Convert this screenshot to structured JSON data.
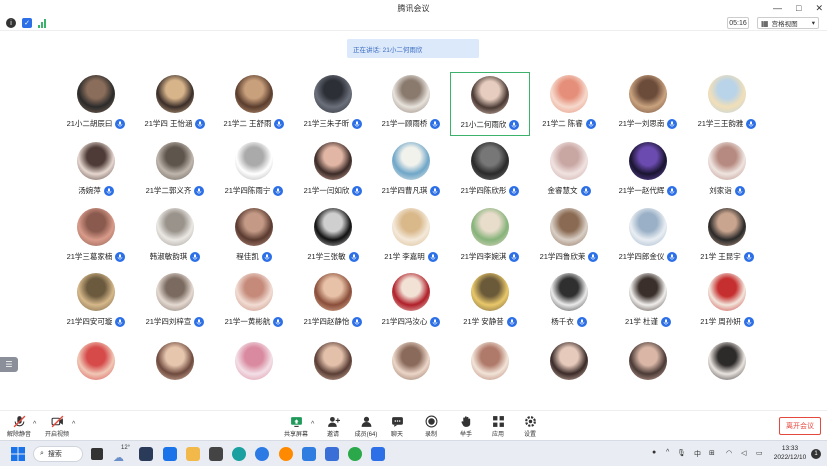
{
  "window": {
    "title": "腾讯会议"
  },
  "infobar": {
    "timer": "05:16",
    "view_label": "宫格视图"
  },
  "speaker": {
    "text": "正在讲话: 21小二何雨欣"
  },
  "participants": [
    {
      "name": "21小二胡辰曰",
      "c1": "#2b2b2b",
      "c2": "#8a6d5a"
    },
    {
      "name": "21学四 王怡涵",
      "c1": "#3a2e2a",
      "c2": "#d8b48a"
    },
    {
      "name": "21学二 王舒雨",
      "c1": "#5a3d2e",
      "c2": "#c9a07c"
    },
    {
      "name": "21学三朱子昕",
      "c1": "#6a6f7a",
      "c2": "#2d2f36"
    },
    {
      "name": "21学一顾雨桥",
      "c1": "#e7e2dc",
      "c2": "#8a7a6e"
    },
    {
      "name": "21小二何雨欣",
      "c1": "#4a3a34",
      "c2": "#e7cdbf"
    },
    {
      "name": "21学二 陈睿",
      "c1": "#f6d9cc",
      "c2": "#e58f7a"
    },
    {
      "name": "21学一刘思南",
      "c1": "#c9a27e",
      "c2": "#6b4b3a"
    },
    {
      "name": "21学三王韵雅",
      "c1": "#f2dfb7",
      "c2": "#b9d3e8"
    },
    {
      "name": "汤婉萍",
      "c1": "#e6d7d0",
      "c2": "#4e3a36"
    },
    {
      "name": "21学二郭义齐",
      "c1": "#bfb6ad",
      "c2": "#5e554d"
    },
    {
      "name": "21学四陈雨宁",
      "c1": "#ffffff",
      "c2": "#aaaaaa"
    },
    {
      "name": "21学一闫如欣",
      "c1": "#3b2b28",
      "c2": "#e2b6a4"
    },
    {
      "name": "21学四曹凡琪",
      "c1": "#6fa6c8",
      "c2": "#f2f2ec"
    },
    {
      "name": "21学四陈欣彤",
      "c1": "#2a2a2a",
      "c2": "#777777"
    },
    {
      "name": "金睿慧文",
      "c1": "#f0e2e0",
      "c2": "#c8a6a2"
    },
    {
      "name": "21学一赵代辉",
      "c1": "#1a1530",
      "c2": "#6b4bb0"
    },
    {
      "name": "刘家诣",
      "c1": "#efe4e0",
      "c2": "#b68a80"
    },
    {
      "name": "21学三葛家楠",
      "c1": "#d99b8a",
      "c2": "#8a5a4e"
    },
    {
      "name": "韩淑敏韵琪",
      "c1": "#ebe8e4",
      "c2": "#9a938c"
    },
    {
      "name": "程佳凯",
      "c1": "#5a3a30",
      "c2": "#c49a86"
    },
    {
      "name": "21学三张敏",
      "c1": "#111111",
      "c2": "#cfcfcf"
    },
    {
      "name": "21学 李嘉明",
      "c1": "#f4e9da",
      "c2": "#d9b88a"
    },
    {
      "name": "21学四李婉淇",
      "c1": "#86b37a",
      "c2": "#e8dccb"
    },
    {
      "name": "21学四鲁欣茉",
      "c1": "#d9cfc6",
      "c2": "#8a6a52"
    },
    {
      "name": "21学四郎金仪",
      "c1": "#e9eef3",
      "c2": "#9ab0c6"
    },
    {
      "name": "21学 王昆宇",
      "c1": "#2a2a2a",
      "c2": "#c9a48e"
    },
    {
      "name": "21学四安可璇",
      "c1": "#d6b88a",
      "c2": "#6b5a3e"
    },
    {
      "name": "21学四刘梓宣",
      "c1": "#e5dad2",
      "c2": "#7a6a60"
    },
    {
      "name": "21学一黄彬航",
      "c1": "#f1dcd3",
      "c2": "#c58a7a"
    },
    {
      "name": "21学四赵静怡",
      "c1": "#8a4e3a",
      "c2": "#e8c2a8"
    },
    {
      "name": "21学四冯汝心",
      "c1": "#b0202a",
      "c2": "#f2e2d6"
    },
    {
      "name": "21学 安静昔",
      "c1": "#e9c86a",
      "c2": "#6b5a3a"
    },
    {
      "name": "杨千衣",
      "c1": "#eaeaea",
      "c2": "#2f2f2f"
    },
    {
      "name": "21学 杜谨",
      "c1": "#f0eeec",
      "c2": "#3a2f2a"
    },
    {
      "name": "21学 周孙妍",
      "c1": "#f2e6dc",
      "c2": "#c62f2f"
    },
    {
      "name": "",
      "c1": "#f0c8b6",
      "c2": "#d64a4a"
    },
    {
      "name": "",
      "c1": "#6e4a3e",
      "c2": "#e7c6ae"
    },
    {
      "name": "",
      "c1": "#f3dfe6",
      "c2": "#d98aa0"
    },
    {
      "name": "",
      "c1": "#5a3e36",
      "c2": "#e3c0aa"
    },
    {
      "name": "",
      "c1": "#ecd6c8",
      "c2": "#8a6a5a"
    },
    {
      "name": "",
      "c1": "#f2e4d8",
      "c2": "#b07a6a"
    },
    {
      "name": "",
      "c1": "#3a2a28",
      "c2": "#e6cabb"
    },
    {
      "name": "",
      "c1": "#4a3a36",
      "c2": "#d9b6a6"
    },
    {
      "name": "",
      "c1": "#eae4df",
      "c2": "#2d2a2a"
    }
  ],
  "toolbar": {
    "mute": "解除静音",
    "video": "开启视频",
    "share": "共享屏幕",
    "invite": "邀请",
    "members": "成员(64)",
    "chat": "聊天",
    "record": "录制",
    "raise": "举手",
    "apps": "应用",
    "settings": "设置",
    "leave": "离开会议"
  },
  "taskbar": {
    "search": "搜索",
    "weather": "12°",
    "time": "13:33",
    "date": "2022/12/10",
    "lang": "中",
    "notif": "1"
  },
  "colors": {
    "accent": "#2c6fe6",
    "active_border": "#3bb36a",
    "leave": "#e5483d",
    "banner_bg": "#dce9fb"
  }
}
